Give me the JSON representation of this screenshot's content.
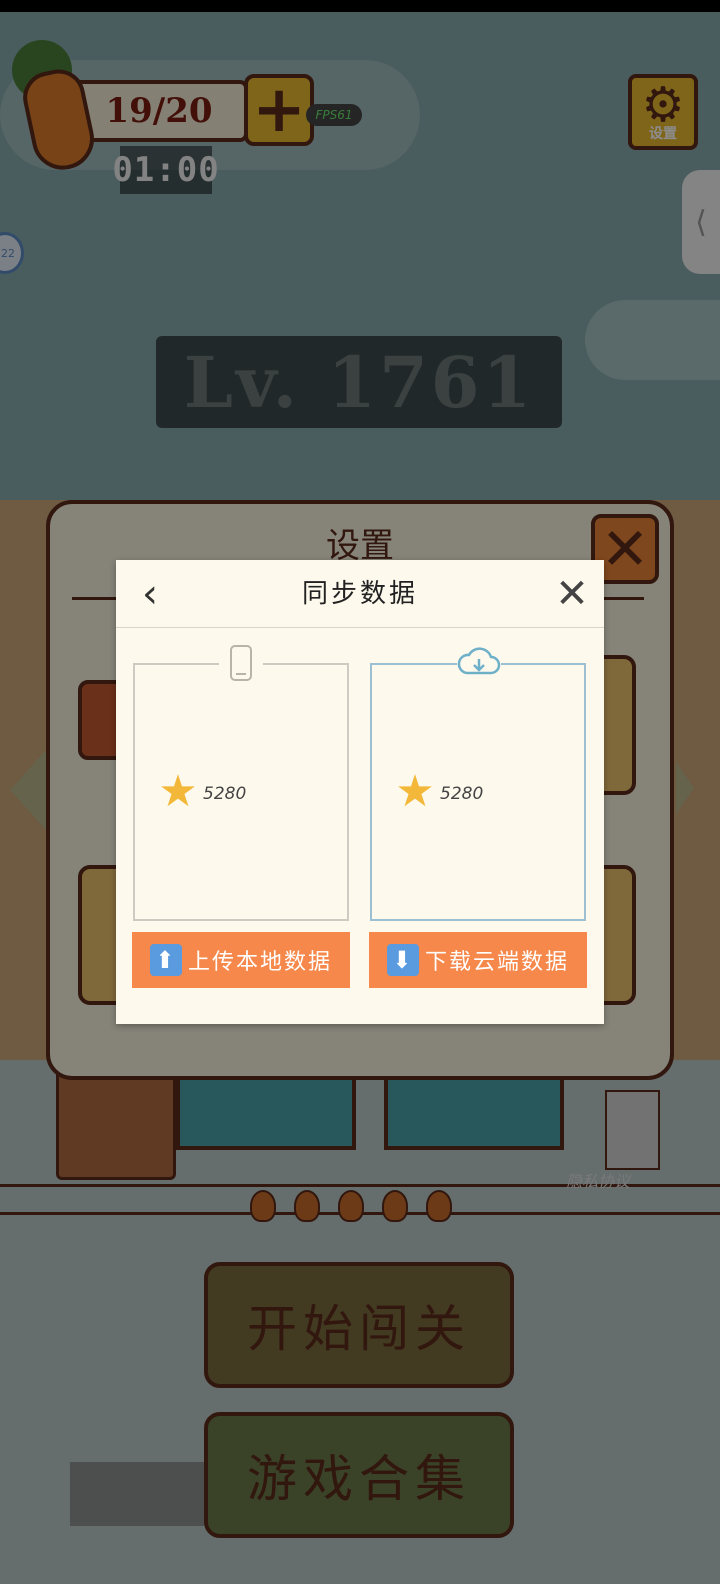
{
  "hud": {
    "energy": "19/20",
    "plus_label": "+",
    "fps": "FPS61",
    "timer": "01:00",
    "settings_label": "设置",
    "side_tab_glyph": "⟨",
    "badge_number": "22"
  },
  "level": {
    "text": "Lv. 1761"
  },
  "settings_panel": {
    "title": "设置",
    "close_glyph": "✕"
  },
  "footer": {
    "privacy": "隐私协议",
    "start_button": "开始闯关",
    "collection_button": "游戏合集"
  },
  "sync_modal": {
    "back_glyph": "‹",
    "title": "同步数据",
    "close_glyph": "✕",
    "local": {
      "score": "5280",
      "button_icon": "⬆",
      "button_label": "上传本地数据"
    },
    "cloud": {
      "score": "5280",
      "button_icon": "⬇",
      "button_label": "下载云端数据"
    }
  },
  "colors": {
    "accent_orange": "#f5884a",
    "modal_bg": "#fdfaed",
    "star": "#f3b83a",
    "cloud_border": "#9cc0d2"
  },
  "icons": [
    "carrot-icon",
    "gear-icon",
    "phone-icon",
    "cloud-download-icon",
    "star-icon",
    "upload-arrow-icon",
    "download-arrow-icon"
  ]
}
